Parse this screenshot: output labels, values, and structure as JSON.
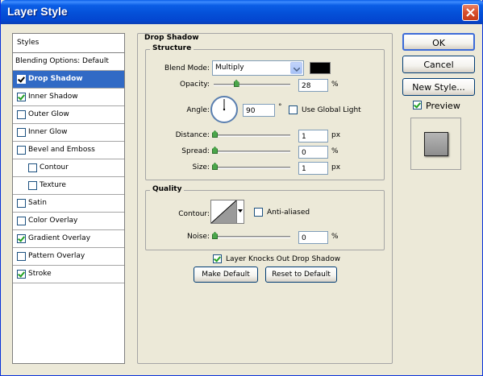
{
  "window": {
    "title": "Layer Style"
  },
  "styles": {
    "header": "Styles",
    "blending": "Blending Options: Default",
    "items": [
      {
        "label": "Drop Shadow",
        "checked": true,
        "selected": true,
        "indent": false
      },
      {
        "label": "Inner Shadow",
        "checked": true,
        "selected": false,
        "indent": false
      },
      {
        "label": "Outer Glow",
        "checked": false,
        "selected": false,
        "indent": false
      },
      {
        "label": "Inner Glow",
        "checked": false,
        "selected": false,
        "indent": false
      },
      {
        "label": "Bevel and Emboss",
        "checked": false,
        "selected": false,
        "indent": false
      },
      {
        "label": "Contour",
        "checked": false,
        "selected": false,
        "indent": true
      },
      {
        "label": "Texture",
        "checked": false,
        "selected": false,
        "indent": true
      },
      {
        "label": "Satin",
        "checked": false,
        "selected": false,
        "indent": false
      },
      {
        "label": "Color Overlay",
        "checked": false,
        "selected": false,
        "indent": false
      },
      {
        "label": "Gradient Overlay",
        "checked": true,
        "selected": false,
        "indent": false
      },
      {
        "label": "Pattern Overlay",
        "checked": false,
        "selected": false,
        "indent": false
      },
      {
        "label": "Stroke",
        "checked": true,
        "selected": false,
        "indent": false
      }
    ]
  },
  "panel": {
    "title": "Drop Shadow",
    "structure": {
      "title": "Structure",
      "blend_mode_label": "Blend Mode:",
      "blend_mode_value": "Multiply",
      "shadow_color": "#000000",
      "opacity_label": "Opacity:",
      "opacity_value": "28",
      "opacity_fraction": 0.28,
      "percent": "%",
      "angle_label": "Angle:",
      "angle_value": "90",
      "degree": "°",
      "use_global_light": "Use Global Light",
      "distance_label": "Distance:",
      "distance_value": "1",
      "px": "px",
      "spread_label": "Spread:",
      "spread_value": "0",
      "size_label": "Size:",
      "size_value": "1"
    },
    "quality": {
      "title": "Quality",
      "contour_label": "Contour:",
      "anti_aliased": "Anti-aliased",
      "noise_label": "Noise:",
      "noise_value": "0",
      "percent": "%"
    },
    "knockout": "Layer Knocks Out Drop Shadow",
    "make_default": "Make Default",
    "reset_default": "Reset to Default"
  },
  "buttons": {
    "ok": "OK",
    "cancel": "Cancel",
    "new_style": "New Style...",
    "preview": "Preview"
  }
}
